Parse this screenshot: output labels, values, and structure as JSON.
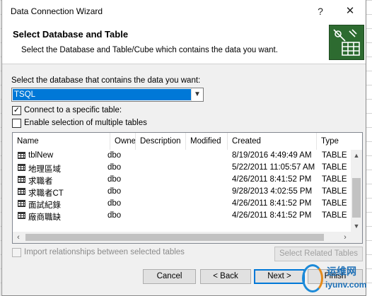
{
  "window": {
    "title": "Data Connection Wizard",
    "help_glyph": "?",
    "close_glyph": "✕"
  },
  "header": {
    "title": "Select Database and Table",
    "subtitle": "Select the Database and Table/Cube which contains the data you want.",
    "icon": "database-wizard-icon"
  },
  "database": {
    "label": "Select the database that contains the data you want:",
    "selected": "TSQL"
  },
  "options": {
    "connect_specific_label": "Connect to a specific table:",
    "connect_specific_checked": true,
    "enable_multiple_label": "Enable selection of multiple tables",
    "enable_multiple_checked": false,
    "import_relationships_label": "Import relationships between selected tables",
    "import_relationships_checked": false
  },
  "table": {
    "columns": [
      "Name",
      "Owner",
      "Description",
      "Modified",
      "Created",
      "Type"
    ],
    "rows": [
      {
        "name": "tblNew",
        "owner": "dbo",
        "description": "",
        "modified": "",
        "created": "8/19/2016 4:49:49 AM",
        "type": "TABLE"
      },
      {
        "name": "地理區域",
        "owner": "dbo",
        "description": "",
        "modified": "",
        "created": "5/22/2011 11:05:57 AM",
        "type": "TABLE"
      },
      {
        "name": "求職者",
        "owner": "dbo",
        "description": "",
        "modified": "",
        "created": "4/26/2011 8:41:52 PM",
        "type": "TABLE"
      },
      {
        "name": "求職者CT",
        "owner": "dbo",
        "description": "",
        "modified": "",
        "created": "9/28/2013 4:02:55 PM",
        "type": "TABLE"
      },
      {
        "name": "面試紀錄",
        "owner": "dbo",
        "description": "",
        "modified": "",
        "created": "4/26/2011 8:41:52 PM",
        "type": "TABLE"
      },
      {
        "name": "廠商職缺",
        "owner": "dbo",
        "description": "",
        "modified": "",
        "created": "4/26/2011 8:41:52 PM",
        "type": "TABLE"
      }
    ]
  },
  "buttons": {
    "select_related": "Select Related Tables",
    "cancel": "Cancel",
    "back": "< Back",
    "next": "Next >",
    "finish": "Finish"
  },
  "watermark": {
    "line1": "运维网",
    "line2": "iyunv.com"
  },
  "colors": {
    "selection": "#0078d7",
    "dialog_bg": "#f0f0f0"
  }
}
